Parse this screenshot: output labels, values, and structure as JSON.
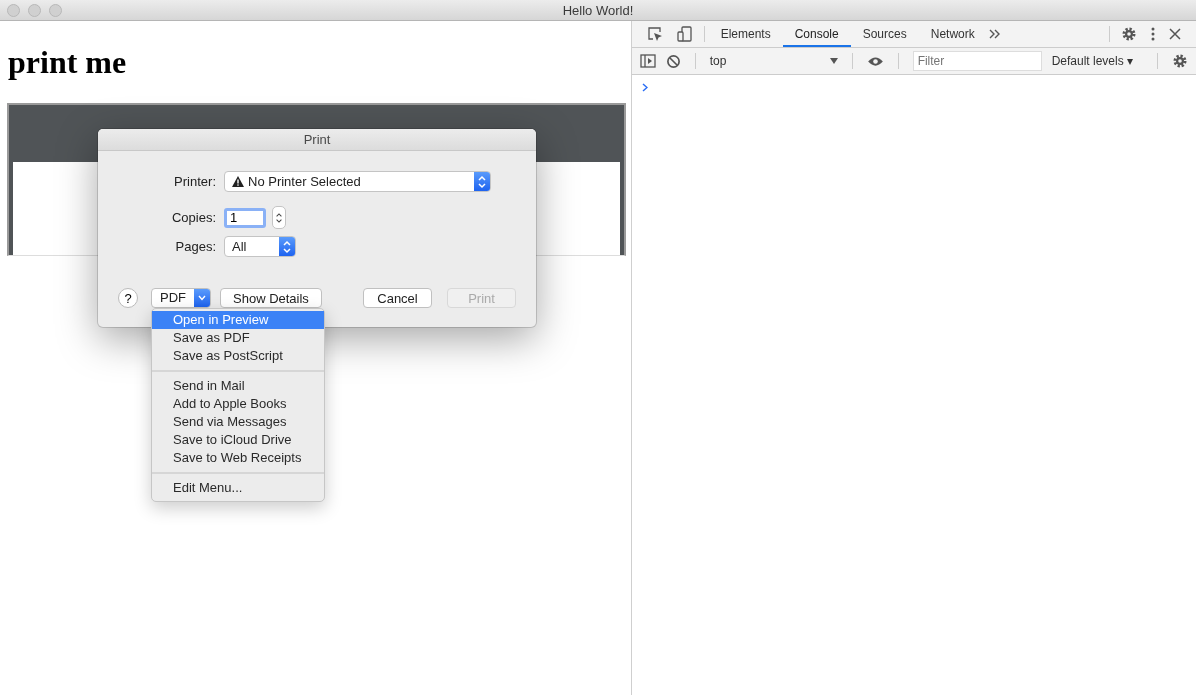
{
  "window": {
    "title": "Hello World!"
  },
  "page": {
    "heading": "print me"
  },
  "print_dialog": {
    "title": "Print",
    "printer": {
      "label": "Printer:",
      "value": "No Printer Selected"
    },
    "copies": {
      "label": "Copies:",
      "value": "1"
    },
    "pages": {
      "label": "Pages:",
      "value": "All"
    },
    "help": "?",
    "pdf": "PDF",
    "show_details": {
      "label": "Show Details",
      "disabled": false
    },
    "cancel": {
      "label": "Cancel",
      "disabled": false
    },
    "print": {
      "label": "Print",
      "disabled": true
    }
  },
  "pdf_menu": {
    "groups": [
      [
        {
          "label": "Open in Preview",
          "selected": true
        },
        {
          "label": "Save as PDF",
          "selected": false
        },
        {
          "label": "Save as PostScript",
          "selected": false
        }
      ],
      [
        {
          "label": "Send in Mail",
          "selected": false
        },
        {
          "label": "Add to Apple Books",
          "selected": false
        },
        {
          "label": "Send via Messages",
          "selected": false
        },
        {
          "label": "Save to iCloud Drive",
          "selected": false
        },
        {
          "label": "Save to Web Receipts",
          "selected": false
        }
      ],
      [
        {
          "label": "Edit Menu...",
          "selected": false
        }
      ]
    ]
  },
  "devtools": {
    "tabs": [
      {
        "label": "Elements",
        "selected": false
      },
      {
        "label": "Console",
        "selected": true
      },
      {
        "label": "Sources",
        "selected": false
      },
      {
        "label": "Network",
        "selected": false
      }
    ],
    "context": "top",
    "filter": {
      "placeholder": "Filter"
    },
    "levels": "Default levels ▾"
  }
}
